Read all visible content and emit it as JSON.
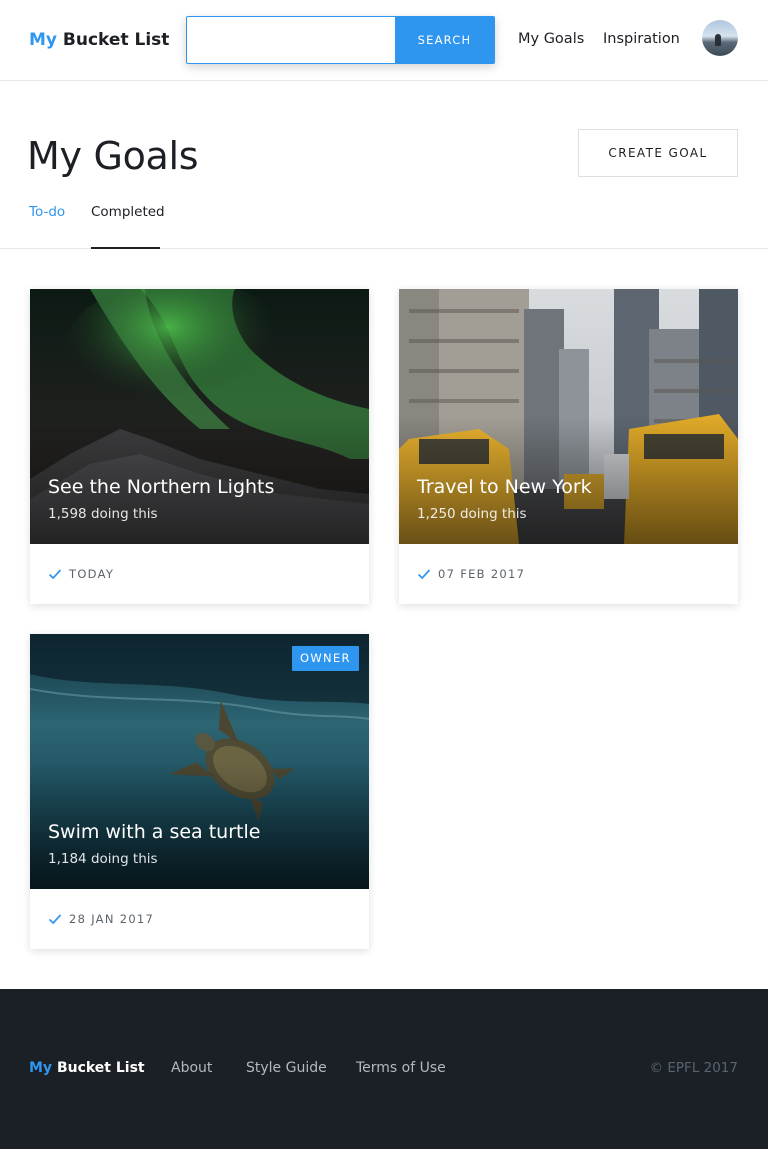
{
  "header": {
    "logo_my": "My",
    "logo_rest": "Bucket List",
    "search": {
      "placeholder": "",
      "value": "",
      "button_label": "SEARCH"
    },
    "nav": [
      {
        "label": "My Goals"
      },
      {
        "label": "Inspiration"
      }
    ],
    "avatar_icon": "user-avatar"
  },
  "page": {
    "title": "My Goals",
    "create_label": "CREATE GOAL",
    "tabs": [
      {
        "label": "To-do",
        "active": false
      },
      {
        "label": "Completed",
        "active": true
      }
    ]
  },
  "goals": [
    {
      "title": "See the Northern Lights",
      "subtitle": "1,598 doing this",
      "date": "TODAY",
      "image": "aurora-mountains",
      "owner": false
    },
    {
      "title": "Travel to New York",
      "subtitle": "1,250 doing this",
      "date": "07 FEB 2017",
      "image": "new-york-taxis",
      "owner": false
    },
    {
      "title": "Swim with a sea turtle",
      "subtitle": "1,184 doing this",
      "date": "28 JAN 2017",
      "image": "sea-turtle-underwater",
      "owner": true,
      "badge": "OWNER"
    }
  ],
  "footer": {
    "logo_my": "My",
    "logo_rest": "Bucket List",
    "links": [
      {
        "label": "About"
      },
      {
        "label": "Style Guide"
      },
      {
        "label": "Terms of Use"
      }
    ],
    "copyright": "© EPFL 2017"
  },
  "colors": {
    "accent": "#2f96f0",
    "text": "#1c1f24",
    "footer_bg": "#1b2027"
  }
}
